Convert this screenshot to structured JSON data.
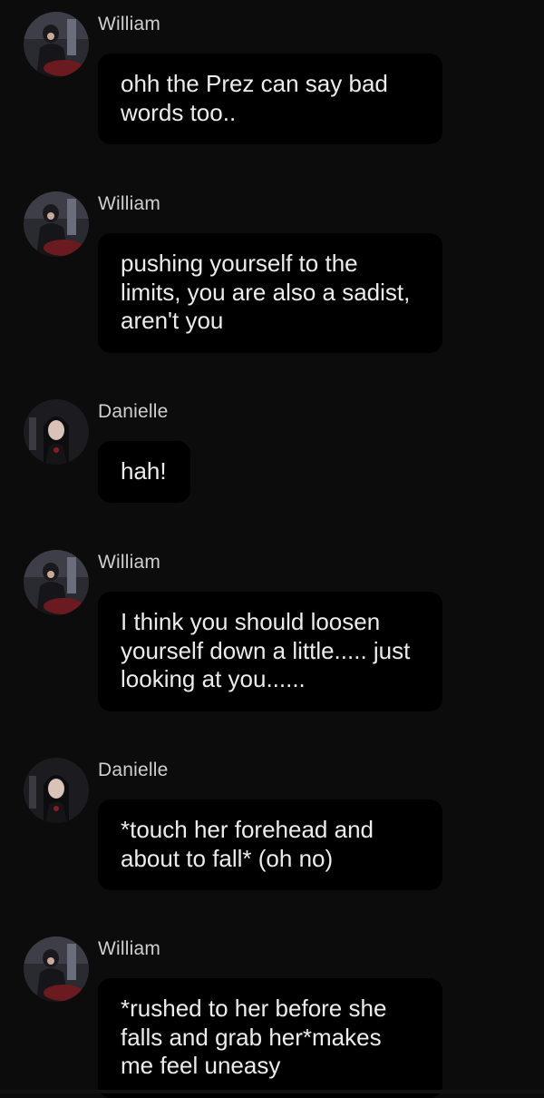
{
  "messages": [
    {
      "sender": "William",
      "text": "ohh the Prez can say bad words too.."
    },
    {
      "sender": "William",
      "text": "pushing yourself to the limits, you are also a sadist, aren't you"
    },
    {
      "sender": "Danielle",
      "text": "hah!"
    },
    {
      "sender": "William",
      "text": "I think you should loosen yourself down a little..... just looking at you......"
    },
    {
      "sender": "Danielle",
      "text": "*touch her forehead and about to fall* (oh no)"
    },
    {
      "sender": "William",
      "text": "*rushed to her before she falls and grab her*makes me feel uneasy"
    }
  ],
  "colors": {
    "background": "#0c0c0c",
    "bubble": "#000000",
    "name": "#cfcfcf",
    "text": "#ececec"
  }
}
